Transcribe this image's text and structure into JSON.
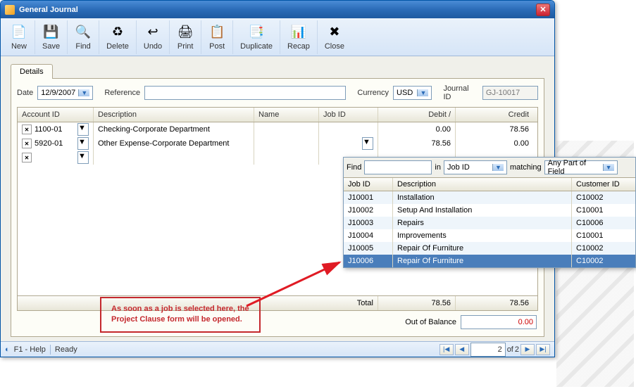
{
  "window": {
    "title": "General Journal"
  },
  "toolbar": [
    {
      "label": "New",
      "icon": "📄",
      "name": "new-button"
    },
    {
      "label": "Save",
      "icon": "💾",
      "name": "save-button"
    },
    {
      "label": "Find",
      "icon": "🔍",
      "name": "find-button"
    },
    {
      "label": "Delete",
      "icon": "♻",
      "name": "delete-button"
    },
    {
      "label": "Undo",
      "icon": "↩",
      "name": "undo-button"
    },
    {
      "label": "Print",
      "icon": "🖨",
      "name": "print-button"
    },
    {
      "label": "Post",
      "icon": "📋",
      "name": "post-button"
    },
    {
      "label": "Duplicate",
      "icon": "📑",
      "name": "duplicate-button"
    },
    {
      "label": "Recap",
      "icon": "📊",
      "name": "recap-button"
    },
    {
      "label": "Close",
      "icon": "✖",
      "name": "close-button"
    }
  ],
  "tabs": {
    "details": "Details"
  },
  "header": {
    "date_label": "Date",
    "date_value": "12/9/2007",
    "reference_label": "Reference",
    "reference_value": "",
    "currency_label": "Currency",
    "currency_value": "USD",
    "journalid_label": "Journal ID",
    "journalid_value": "GJ-10017"
  },
  "grid": {
    "columns": {
      "account": "Account ID",
      "description": "Description",
      "name": "Name",
      "job": "Job ID",
      "debit": "Debit /",
      "credit": "Credit"
    },
    "rows": [
      {
        "account": "1100-01",
        "description": "Checking-Corporate Department",
        "name": "",
        "job": "",
        "debit": "0.00",
        "credit": "78.56"
      },
      {
        "account": "5920-01",
        "description": "Other Expense-Corporate Department",
        "name": "",
        "job": "",
        "debit": "78.56",
        "credit": "0.00"
      },
      {
        "account": "",
        "description": "",
        "name": "",
        "job": "",
        "debit": "",
        "credit": ""
      }
    ],
    "total_label": "Total",
    "total_debit": "78.56",
    "total_credit": "78.56",
    "balance_label": "Out of Balance",
    "balance_value": "0.00"
  },
  "popup": {
    "find_label": "Find",
    "find_value": "",
    "in_label": "in",
    "in_value": "Job ID",
    "matching_label": "matching",
    "matching_value": "Any Part of Field",
    "columns": {
      "job": "Job ID",
      "desc": "Description",
      "cust": "Customer ID"
    },
    "rows": [
      {
        "job": "J10001",
        "desc": "Installation",
        "cust": "C10002"
      },
      {
        "job": "J10002",
        "desc": "Setup And Installation",
        "cust": "C10001"
      },
      {
        "job": "J10003",
        "desc": "Repairs",
        "cust": "C10006"
      },
      {
        "job": "J10004",
        "desc": "Improvements",
        "cust": "C10001"
      },
      {
        "job": "J10005",
        "desc": "Repair Of Furniture",
        "cust": "C10002"
      },
      {
        "job": "J10006",
        "desc": "Repair Of Furniture",
        "cust": "C10002"
      }
    ],
    "selected_index": 5
  },
  "status": {
    "help": "F1 - Help",
    "ready": "Ready",
    "page_current": "2",
    "page_of": "of",
    "page_total": "2"
  },
  "annotation": {
    "line1": "As soon as a job is selected here, the",
    "line2": "Project Clause form will be opened."
  }
}
